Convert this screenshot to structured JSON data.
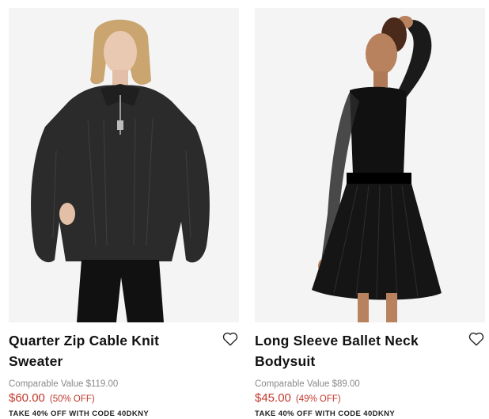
{
  "products": [
    {
      "title": "Quarter Zip Cable Knit Sweater",
      "comparable": "Comparable Value $119.00",
      "price": "$60.00",
      "discount": "(50% OFF)",
      "promo": "TAKE 40% OFF WITH CODE 40DKNY",
      "image_icon": "product-photo-sweater",
      "wishlist_icon": "heart-outline-icon"
    },
    {
      "title": "Long Sleeve Ballet Neck Bodysuit",
      "comparable": "Comparable Value $89.00",
      "price": "$45.00",
      "discount": "(49% OFF)",
      "promo": "TAKE 40% OFF WITH CODE 40DKNY",
      "image_icon": "product-photo-bodysuit",
      "wishlist_icon": "heart-outline-icon"
    }
  ],
  "colors": {
    "sale_price": "#c23a2d",
    "comparable": "#8a8a8a",
    "text": "#111111",
    "image_bg": "#f4f4f4"
  }
}
